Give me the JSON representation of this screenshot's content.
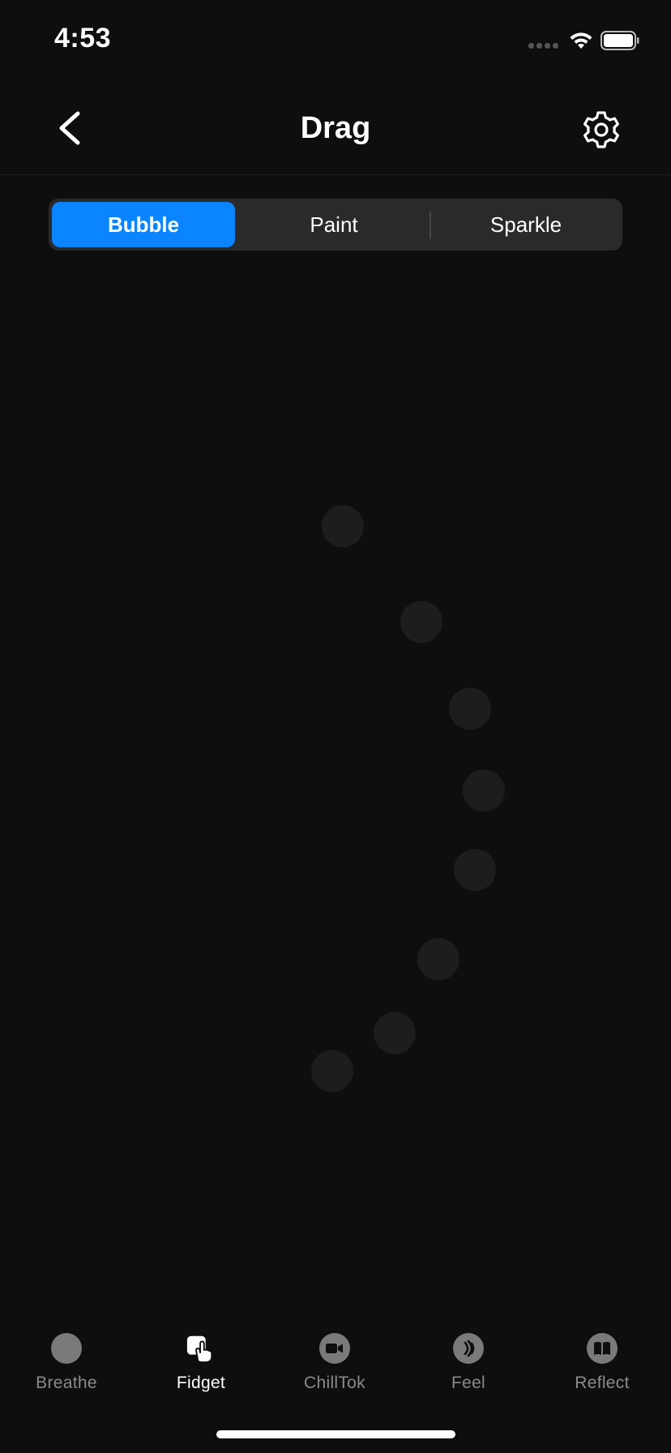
{
  "status_bar": {
    "time": "4:53",
    "signal_icon": "signal-dots-icon",
    "wifi_icon": "wifi-icon",
    "battery_icon": "battery-icon"
  },
  "header": {
    "title": "Drag",
    "back_icon": "chevron-left-icon",
    "settings_icon": "gear-icon"
  },
  "segments": [
    {
      "label": "Bubble",
      "selected": true
    },
    {
      "label": "Paint",
      "selected": false
    },
    {
      "label": "Sparkle",
      "selected": false
    }
  ],
  "tabs": [
    {
      "label": "Breathe",
      "icon": "breathe-circle-icon",
      "active": false
    },
    {
      "label": "Fidget",
      "icon": "fidget-hand-icon",
      "active": true
    },
    {
      "label": "ChillTok",
      "icon": "video-camera-icon",
      "active": false
    },
    {
      "label": "Feel",
      "icon": "vibration-icon",
      "active": false
    },
    {
      "label": "Reflect",
      "icon": "book-icon",
      "active": false
    }
  ],
  "colors": {
    "background": "#0e0e0e",
    "accent": "#0a84ff",
    "segment_bg": "#2a2a2c",
    "bubble": "#1d1d1d",
    "tab_inactive": "#8a8a8e"
  }
}
